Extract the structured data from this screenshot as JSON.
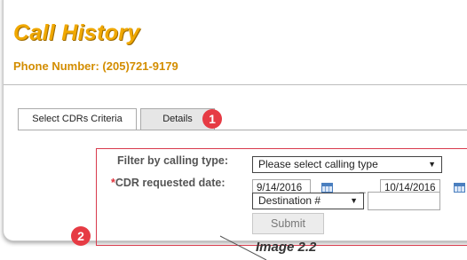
{
  "page": {
    "title": "Call History",
    "phone_label": "Phone Number:",
    "phone_value": "(205)721-9179"
  },
  "tabs": [
    {
      "label": "Select CDRs Criteria",
      "active": true
    },
    {
      "label": "Details",
      "active": false
    }
  ],
  "form": {
    "filter_label": "Filter by calling type:",
    "calltype_selected": "Please select calling type",
    "cdr_required_mark": "*",
    "cdr_label": "CDR requested date:",
    "date_from": "9/14/2016",
    "date_separator": "_",
    "date_to": "10/14/2016",
    "destination_selected": "Destination #",
    "destination_value": "",
    "submit_label": "Submit"
  },
  "callouts": [
    "1",
    "2"
  ],
  "caption": "Image 2.2",
  "colors": {
    "title": "#f0a800",
    "phone": "#d38d00",
    "callout": "#e63b44",
    "highlight_border": "#d83a4c"
  },
  "icons": {
    "dropdown": "chevron-down-icon",
    "calendar": "calendar-icon"
  }
}
